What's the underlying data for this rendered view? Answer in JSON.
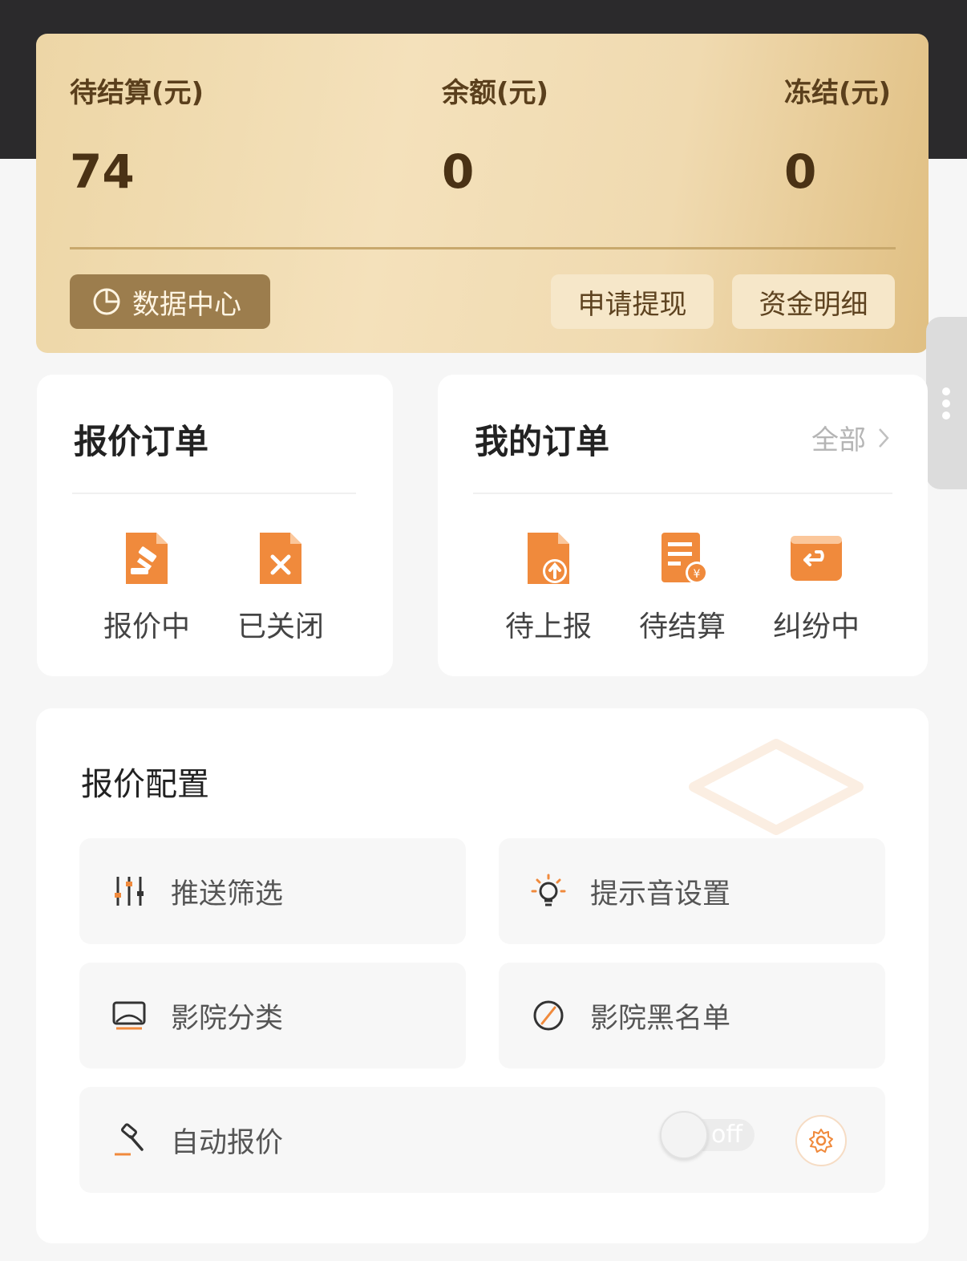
{
  "balance": {
    "pending_label": "待结算(元)",
    "pending_value": "74",
    "balance_label": "余额(元)",
    "balance_value": "0",
    "frozen_label": "冻结(元)",
    "frozen_value": "0",
    "data_center_label": "数据中心",
    "withdraw_label": "申请提现",
    "funds_detail_label": "资金明细"
  },
  "quote_orders": {
    "title": "报价订单",
    "items": [
      {
        "label": "报价中",
        "icon": "gavel-doc-icon"
      },
      {
        "label": "已关闭",
        "icon": "closed-doc-icon"
      }
    ]
  },
  "my_orders": {
    "title": "我的订单",
    "see_all": "全部",
    "items": [
      {
        "label": "待上报",
        "icon": "upload-doc-icon"
      },
      {
        "label": "待结算",
        "icon": "settle-doc-icon"
      },
      {
        "label": "纠纷中",
        "icon": "dispute-box-icon"
      }
    ]
  },
  "config": {
    "title": "报价配置",
    "tiles": [
      {
        "label": "推送筛选",
        "icon": "sliders-icon"
      },
      {
        "label": "提示音设置",
        "icon": "bulb-icon"
      },
      {
        "label": "影院分类",
        "icon": "screen-icon"
      },
      {
        "label": "影院黑名单",
        "icon": "ban-icon"
      }
    ],
    "auto_quote": {
      "label": "自动报价",
      "icon": "hammer-icon",
      "toggle_state": "off",
      "enabled": false
    }
  },
  "colors": {
    "accent": "#f08a3c",
    "gold": "#ecd3a3",
    "dark_gold": "#9c7d4d"
  }
}
